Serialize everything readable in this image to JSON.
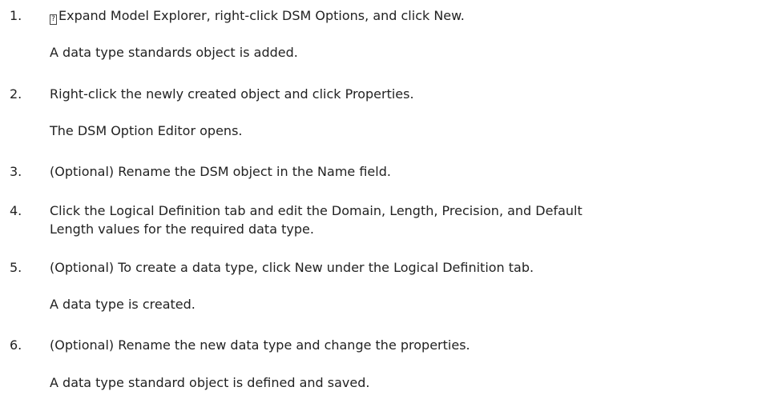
{
  "steps": [
    {
      "number": "1.",
      "glyph": "?",
      "text": "Expand Model Explorer, right-click DSM Options, and click New.",
      "result": "A data type standards object is added."
    },
    {
      "number": "2.",
      "text": "Right-click the newly created object and click Properties.",
      "result": "The DSM Option Editor opens."
    },
    {
      "number": "3.",
      "text": "(Optional) Rename the DSM object in the Name field."
    },
    {
      "number": "4.",
      "text_line1": "Click the Logical Definition tab and edit the Domain, Length, Precision, and Default",
      "text_line2": "Length values for the required data type."
    },
    {
      "number": "5.",
      "text": "(Optional) To create a data type, click New under the Logical Definition tab.",
      "result": "A data type is created."
    },
    {
      "number": "6.",
      "text": "(Optional) Rename the new data type and change the properties.",
      "result": "A data type standard object is defined and saved."
    }
  ]
}
